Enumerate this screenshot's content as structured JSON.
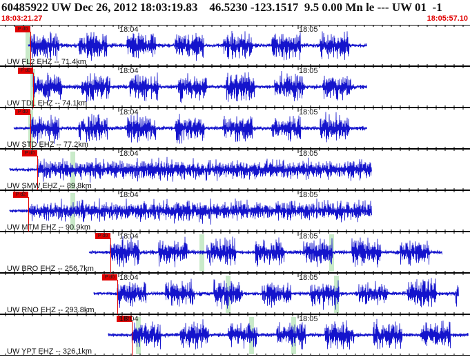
{
  "header": {
    "title": "60485922 UW Dec 26, 2012 18:03:19.83    46.5230 -123.1517  9.5 0.00 Mn le --- UW 01  -1",
    "start_time": "18:03:21.27",
    "end_time": "18:05:57.10"
  },
  "traces": [
    {
      "label": "UW FL2 EHZ -- 71.4km",
      "pick": "P d0",
      "times": [
        "18:04",
        "18:05"
      ],
      "segments": [
        [
          0.06,
          0.78
        ]
      ],
      "pick_pos": 0.065,
      "green": [
        0.055
      ]
    },
    {
      "label": "UW TDL EHZ -- 74.1km",
      "pick": "P d0",
      "times": [
        "18:04",
        "18:05"
      ],
      "segments": [
        [
          0.07,
          0.78
        ]
      ],
      "pick_pos": 0.07,
      "green": [
        0.065
      ]
    },
    {
      "label": "UW STD EHZ -- 77.2km",
      "pick": "P d0",
      "times": [
        "18:04",
        "18:05"
      ],
      "segments": [
        [
          0.03,
          0.78
        ]
      ],
      "pick_pos": 0.065,
      "green": [
        0.06
      ]
    },
    {
      "label": "UW SMW EHZ -- 89.8km",
      "pick": "P d0",
      "times": [
        "18:04",
        "18:05"
      ],
      "segments": [
        [
          0.02,
          0.79
        ]
      ],
      "pick_pos": 0.08,
      "green": [
        0.15
      ]
    },
    {
      "label": "UW MTM EHZ -- 90.9km",
      "pick": "P d2",
      "times": [
        "18:04",
        "18:05"
      ],
      "segments": [
        [
          0.02,
          0.79
        ]
      ],
      "pick_pos": 0.06,
      "green": [
        0.15
      ]
    },
    {
      "label": "UW BRO EHZ -- 256.7km",
      "pick": "P d0",
      "times": [
        "18:04",
        "18:05"
      ],
      "segments": [
        [
          0.19,
          0.94
        ]
      ],
      "pick_pos": 0.235,
      "green": [
        0.425,
        0.7
      ]
    },
    {
      "label": "UW RNO EHZ -- 293.8km",
      "pick": "P d0",
      "times": [
        "18:04",
        "18:05"
      ],
      "segments": [
        [
          0.2,
          0.975
        ]
      ],
      "pick_pos": 0.25,
      "green": [
        0.48,
        0.71
      ]
    },
    {
      "label": "UW YPT EHZ -- 326.1km",
      "pick": "P d0",
      "times": [
        "18:04",
        "18:05"
      ],
      "segments": [
        [
          0.23,
          0.995
        ]
      ],
      "pick_pos": 0.28,
      "green": [
        0.29,
        0.53,
        0.62
      ]
    }
  ],
  "colors": {
    "trace": "#1414cc",
    "pick": "#e00000",
    "green_band": "#bfe6bf"
  }
}
